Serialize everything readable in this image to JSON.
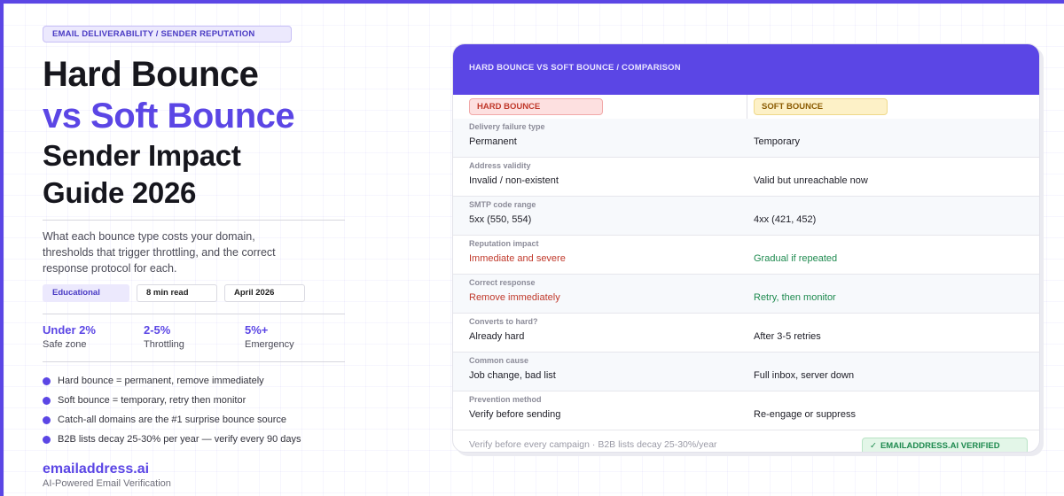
{
  "hero": {
    "eyebrow": "EMAIL DELIVERABILITY / SENDER REPUTATION",
    "title_line1": "Hard Bounce",
    "title_line2": "vs Soft Bounce",
    "title_line3": "Sender Impact",
    "title_line4": "Guide 2026",
    "description": "What each bounce type costs your domain, thresholds that trigger throttling, and the correct response protocol for each.",
    "tags": [
      "Educational",
      "8 min read",
      "April 2026"
    ]
  },
  "stats": [
    {
      "value": "Under 2%",
      "label": "Safe zone"
    },
    {
      "value": "2-5%",
      "label": "Throttling"
    },
    {
      "value": "5%+",
      "label": "Emergency"
    }
  ],
  "bullets": [
    "Hard bounce = permanent, remove immediately",
    "Soft bounce = temporary, retry then monitor",
    "Catch-all domains are the #1 surprise bounce source",
    "B2B lists decay 25-30% per year — verify every 90 days"
  ],
  "brand": {
    "name": "emailaddress.ai",
    "tagline": "AI-Powered Email Verification"
  },
  "comparison": {
    "header": "HARD BOUNCE VS SOFT BOUNCE / COMPARISON",
    "hard_label": "HARD BOUNCE",
    "soft_label": "SOFT BOUNCE",
    "rows": [
      {
        "label": "Delivery failure type",
        "hard": "Permanent",
        "soft": "Temporary"
      },
      {
        "label": "Address validity",
        "hard": "Invalid / non-existent",
        "soft": "Valid but unreachable now"
      },
      {
        "label": "SMTP code range",
        "hard": "5xx (550, 554)",
        "soft": "4xx (421, 452)"
      },
      {
        "label": "Reputation impact",
        "hard": "Immediate and severe",
        "soft": "Gradual if repeated"
      },
      {
        "label": "Correct response",
        "hard": "Remove immediately",
        "soft": "Retry, then monitor"
      },
      {
        "label": "Converts to hard?",
        "hard": "Already hard",
        "soft": "After 3-5 retries"
      },
      {
        "label": "Common cause",
        "hard": "Job change, bad list",
        "soft": "Full inbox, server down"
      },
      {
        "label": "Prevention method",
        "hard": "Verify before sending",
        "soft": "Re-engage or suppress"
      }
    ],
    "footer_note": "Verify before every campaign · B2B lists decay 25-30%/year",
    "verified_badge": "EMAILADDRESS.AI VERIFIED"
  },
  "colors": {
    "accent": "#5b46e5",
    "hard": "#c0392b",
    "soft": "#1e8a4f"
  }
}
